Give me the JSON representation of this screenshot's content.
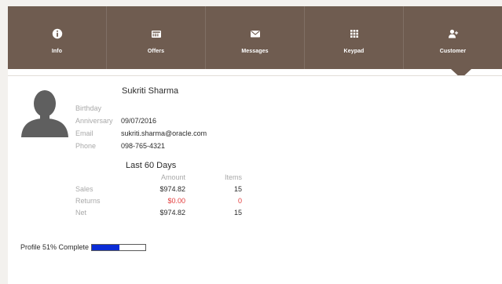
{
  "nav": {
    "tabs": [
      {
        "label": "Info",
        "icon": "info-icon"
      },
      {
        "label": "Offers",
        "icon": "offers-icon"
      },
      {
        "label": "Messages",
        "icon": "envelope-icon"
      },
      {
        "label": "Keypad",
        "icon": "keypad-icon"
      },
      {
        "label": "Customer",
        "icon": "add-user-icon"
      }
    ],
    "active_tab": "Customer",
    "bar_color": "#6f5c50"
  },
  "customer": {
    "name": "Sukriti Sharma",
    "fields": [
      {
        "label": "Birthday",
        "value": ""
      },
      {
        "label": "Anniversary",
        "value": "09/07/2016"
      },
      {
        "label": "Email",
        "value": "sukriti.sharma@oracle.com"
      },
      {
        "label": "Phone",
        "value": "098-765-4321"
      }
    ]
  },
  "stats": {
    "title": "Last 60 Days",
    "columns": [
      "",
      "Amount",
      "Items"
    ],
    "rows": [
      {
        "label": "Sales",
        "amount": "$974.82",
        "items": "15"
      },
      {
        "label": "Returns",
        "amount": "$0.00",
        "items": "0"
      },
      {
        "label": "Net",
        "amount": "$974.82",
        "items": "15"
      }
    ],
    "negative_color": "#e23b3b"
  },
  "profile": {
    "label": "Profile 51% Complete",
    "percent": 51,
    "bar_color": "#0b2cd6"
  }
}
